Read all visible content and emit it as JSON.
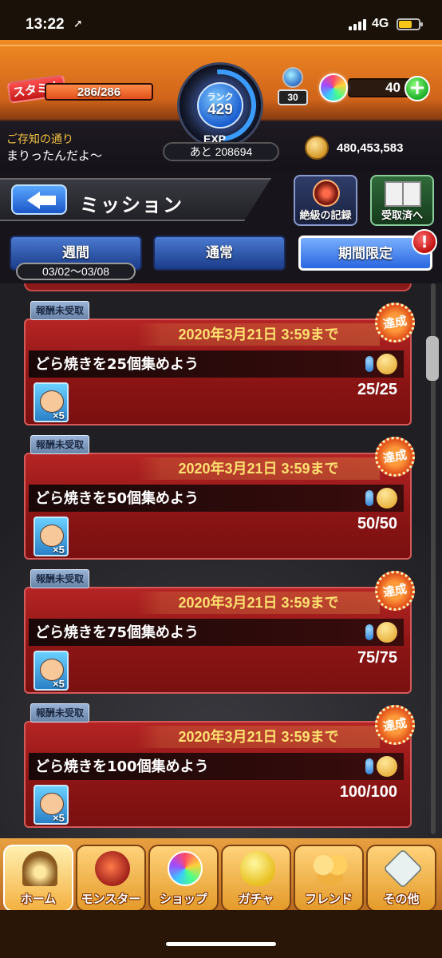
{
  "status_bar": {
    "time": "13:22",
    "location_glyph": "➚",
    "network": "4G"
  },
  "hud": {
    "stamina_label": "スタミナ",
    "stamina": "286/286",
    "stamina_fraction": 1.0,
    "rank_label": "ランク",
    "rank": "429",
    "exp_label": "EXP",
    "exp_remaining": "あと 208694",
    "energy_count": "30",
    "orbs": "40",
    "orb_add": "+",
    "coins": "480,453,583",
    "notice_line1": "ご存知の通り",
    "notice_line2": "まりったんだよ〜"
  },
  "titlebar": {
    "back_icon": "back-arrow-icon",
    "title": "ミッション",
    "record_label": "絶級の記録",
    "received_label": "受取済へ"
  },
  "tabs": {
    "items": [
      {
        "label": "週間"
      },
      {
        "label": "通常"
      },
      {
        "label": "期間限定"
      }
    ],
    "period": "03/02〜03/08",
    "alert": "!"
  },
  "missions": [
    {
      "badge": "報酬未受取",
      "deadline": "2020年3月21日 3:59まで",
      "stamp": "達成",
      "title": "どら焼きを25個集めよう",
      "progress": "25/25",
      "reward_qty": "×5"
    },
    {
      "badge": "報酬未受取",
      "deadline": "2020年3月21日 3:59まで",
      "stamp": "達成",
      "title": "どら焼きを50個集めよう",
      "progress": "50/50",
      "reward_qty": "×5"
    },
    {
      "badge": "報酬未受取",
      "deadline": "2020年3月21日 3:59まで",
      "stamp": "達成",
      "title": "どら焼きを75個集めよう",
      "progress": "75/75",
      "reward_qty": "×5"
    },
    {
      "badge": "報酬未受取",
      "deadline": "2020年3月21日 3:59まで",
      "stamp": "達成",
      "title": "どら焼きを100個集めよう",
      "progress": "100/100",
      "reward_qty": "×5"
    }
  ],
  "bottom_nav": [
    {
      "label": "ホーム",
      "icon": "home-gate-icon"
    },
    {
      "label": "モンスター",
      "icon": "monster-icon"
    },
    {
      "label": "ショップ",
      "icon": "orb-icon"
    },
    {
      "label": "ガチャ",
      "icon": "gacha-egg-icon"
    },
    {
      "label": "フレンド",
      "icon": "friends-icon"
    },
    {
      "label": "その他",
      "icon": "other-icon"
    }
  ],
  "colors": {
    "accent_orange": "#f08a23",
    "card_red": "#b52424",
    "deadline_yellow": "#ffe070",
    "tab_blue": "#2a66e0"
  }
}
